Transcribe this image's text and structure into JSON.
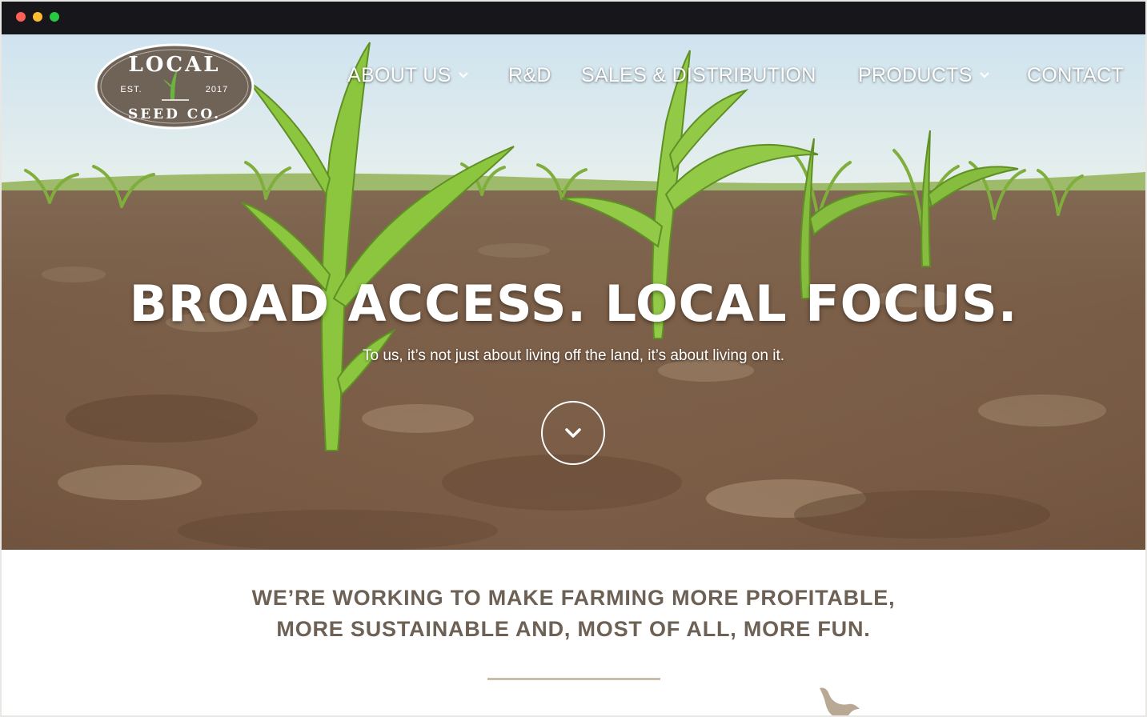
{
  "window": {
    "controls": [
      "close",
      "minimize",
      "maximize"
    ]
  },
  "logo": {
    "top_text": "LOCAL",
    "left_text": "EST.",
    "right_text": "2017",
    "bottom_text": "SEED CO.",
    "icon": "corn-sprout-icon",
    "colors": {
      "fill": "#6f6358",
      "border": "#ffffff",
      "sprout": "#6db33f"
    }
  },
  "nav": {
    "items": [
      {
        "label": "ABOUT US",
        "has_dropdown": true
      },
      {
        "label": "R&D",
        "has_dropdown": false
      },
      {
        "label": "SALES & DISTRIBUTION",
        "has_dropdown": false
      },
      {
        "label": "PRODUCTS",
        "has_dropdown": true
      },
      {
        "label": "CONTACT",
        "has_dropdown": false
      }
    ]
  },
  "hero": {
    "title": "BROAD ACCESS. LOCAL FOCUS.",
    "subtitle": "To us, it’s not just about living off the land, it’s about living on it.",
    "scroll_icon": "chevron-down-icon"
  },
  "mission": {
    "line1": "WE’RE WORKING TO MAKE FARMING MORE PROFITABLE,",
    "line2": "MORE SUSTAINABLE AND, MOST OF ALL, MORE FUN."
  },
  "decor": {
    "bird_icon": "bird-icon"
  },
  "colors": {
    "heading_brown": "#6d6055",
    "divider": "#c9bdaa",
    "titlebar": "#17171b"
  }
}
